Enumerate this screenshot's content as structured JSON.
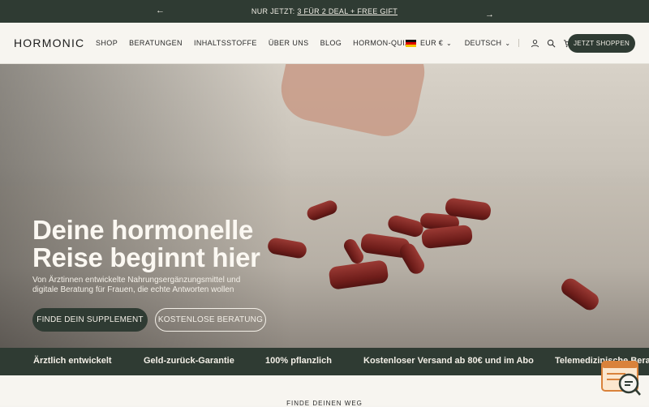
{
  "announcement": {
    "prefix": "NUR JETZT:",
    "link": "3 FÜR 2 DEAL + FREE GIFT"
  },
  "header": {
    "logo": "HORMONIC",
    "nav": [
      "SHOP",
      "BERATUNGEN",
      "INHALTSSTOFFE",
      "ÜBER UNS",
      "BLOG",
      "HORMON-QUIZ"
    ],
    "currency": "EUR €",
    "language": "DEUTSCH",
    "cta": "JETZT SHOPPEN"
  },
  "hero": {
    "headline_line1": "Deine hormonelle",
    "headline_line2": "Reise beginnt hier",
    "subtext": "Von Ärztinnen entwickelte Nahrungsergänzungsmittel und digitale Beratung für Frauen, die echte Antworten wollen",
    "primary_button": "FINDE DEIN SUPPLEMENT",
    "secondary_button": "KOSTENLOSE BERATUNG"
  },
  "features": [
    "Ärztlich entwickelt",
    "Geld-zurück-Garantie",
    "100% pflanzlich",
    "Kostenloser Versand ab 80€ und im Abo",
    "Telemedizinische Beratung"
  ],
  "section": {
    "kicker": "FINDE DEINEN WEG"
  },
  "colors": {
    "primary": "#2f3b33",
    "background": "#f7f5f0",
    "pill": "#7a221e"
  },
  "icons": {
    "prev": "chevron-left-icon",
    "next": "chevron-right-icon",
    "account": "user-icon",
    "search": "search-icon",
    "cart": "cart-icon",
    "chat": "chat-icon"
  }
}
